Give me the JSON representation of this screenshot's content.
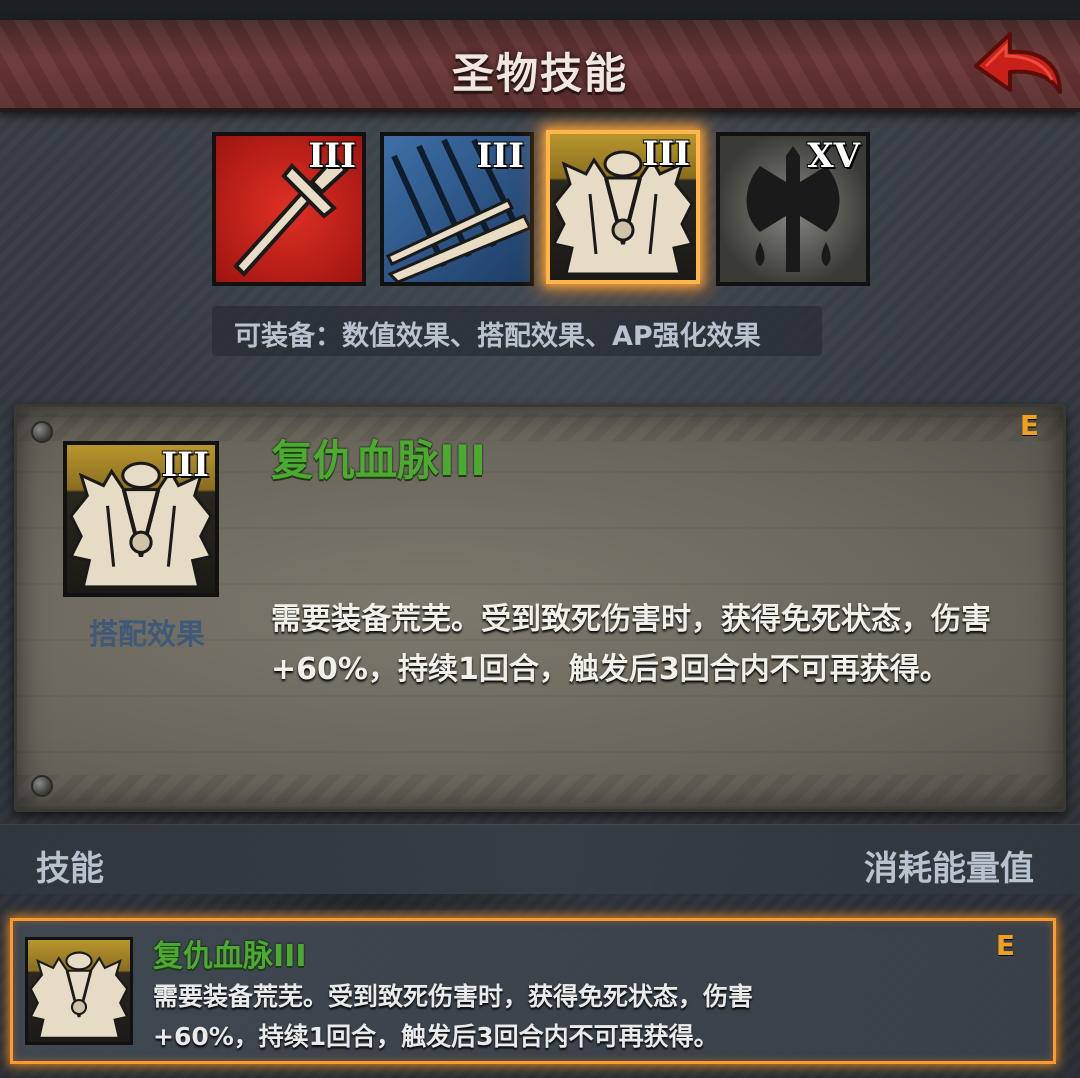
{
  "header": {
    "title": "圣物技能"
  },
  "skill_icons": [
    {
      "name": "sword",
      "level": "III",
      "color": "#c8201a",
      "selected": false
    },
    {
      "name": "claw-slash",
      "level": "III",
      "color": "#2e5a8e",
      "selected": false
    },
    {
      "name": "fur-armor",
      "level": "III",
      "color": "#b8962e",
      "selected": true
    },
    {
      "name": "bleeding-axe",
      "level": "XV",
      "color": "#3a3a38",
      "selected": false
    }
  ],
  "equip_info": "可装备：数值效果、搭配效果、AP强化效果",
  "detail": {
    "level": "III",
    "caption": "搭配效果",
    "title": "复仇血脉III",
    "grade": "E",
    "description": "需要装备荒芜。受到致死伤害时，获得免死状态，伤害+60%，持续1回合，触发后3回合内不可再获得。"
  },
  "list_header": {
    "left": "技能",
    "right": "消耗能量值"
  },
  "list_items": [
    {
      "title": "复仇血脉III",
      "grade": "E",
      "description": "需要装备荒芜。受到致死伤害时，获得免死状态，伤害+60%，持续1回合，触发后3回合内不可再获得。"
    }
  ],
  "colors": {
    "accent": "#ff9a2a",
    "title_green": "#4caa30",
    "grade_orange": "#f0a020"
  }
}
